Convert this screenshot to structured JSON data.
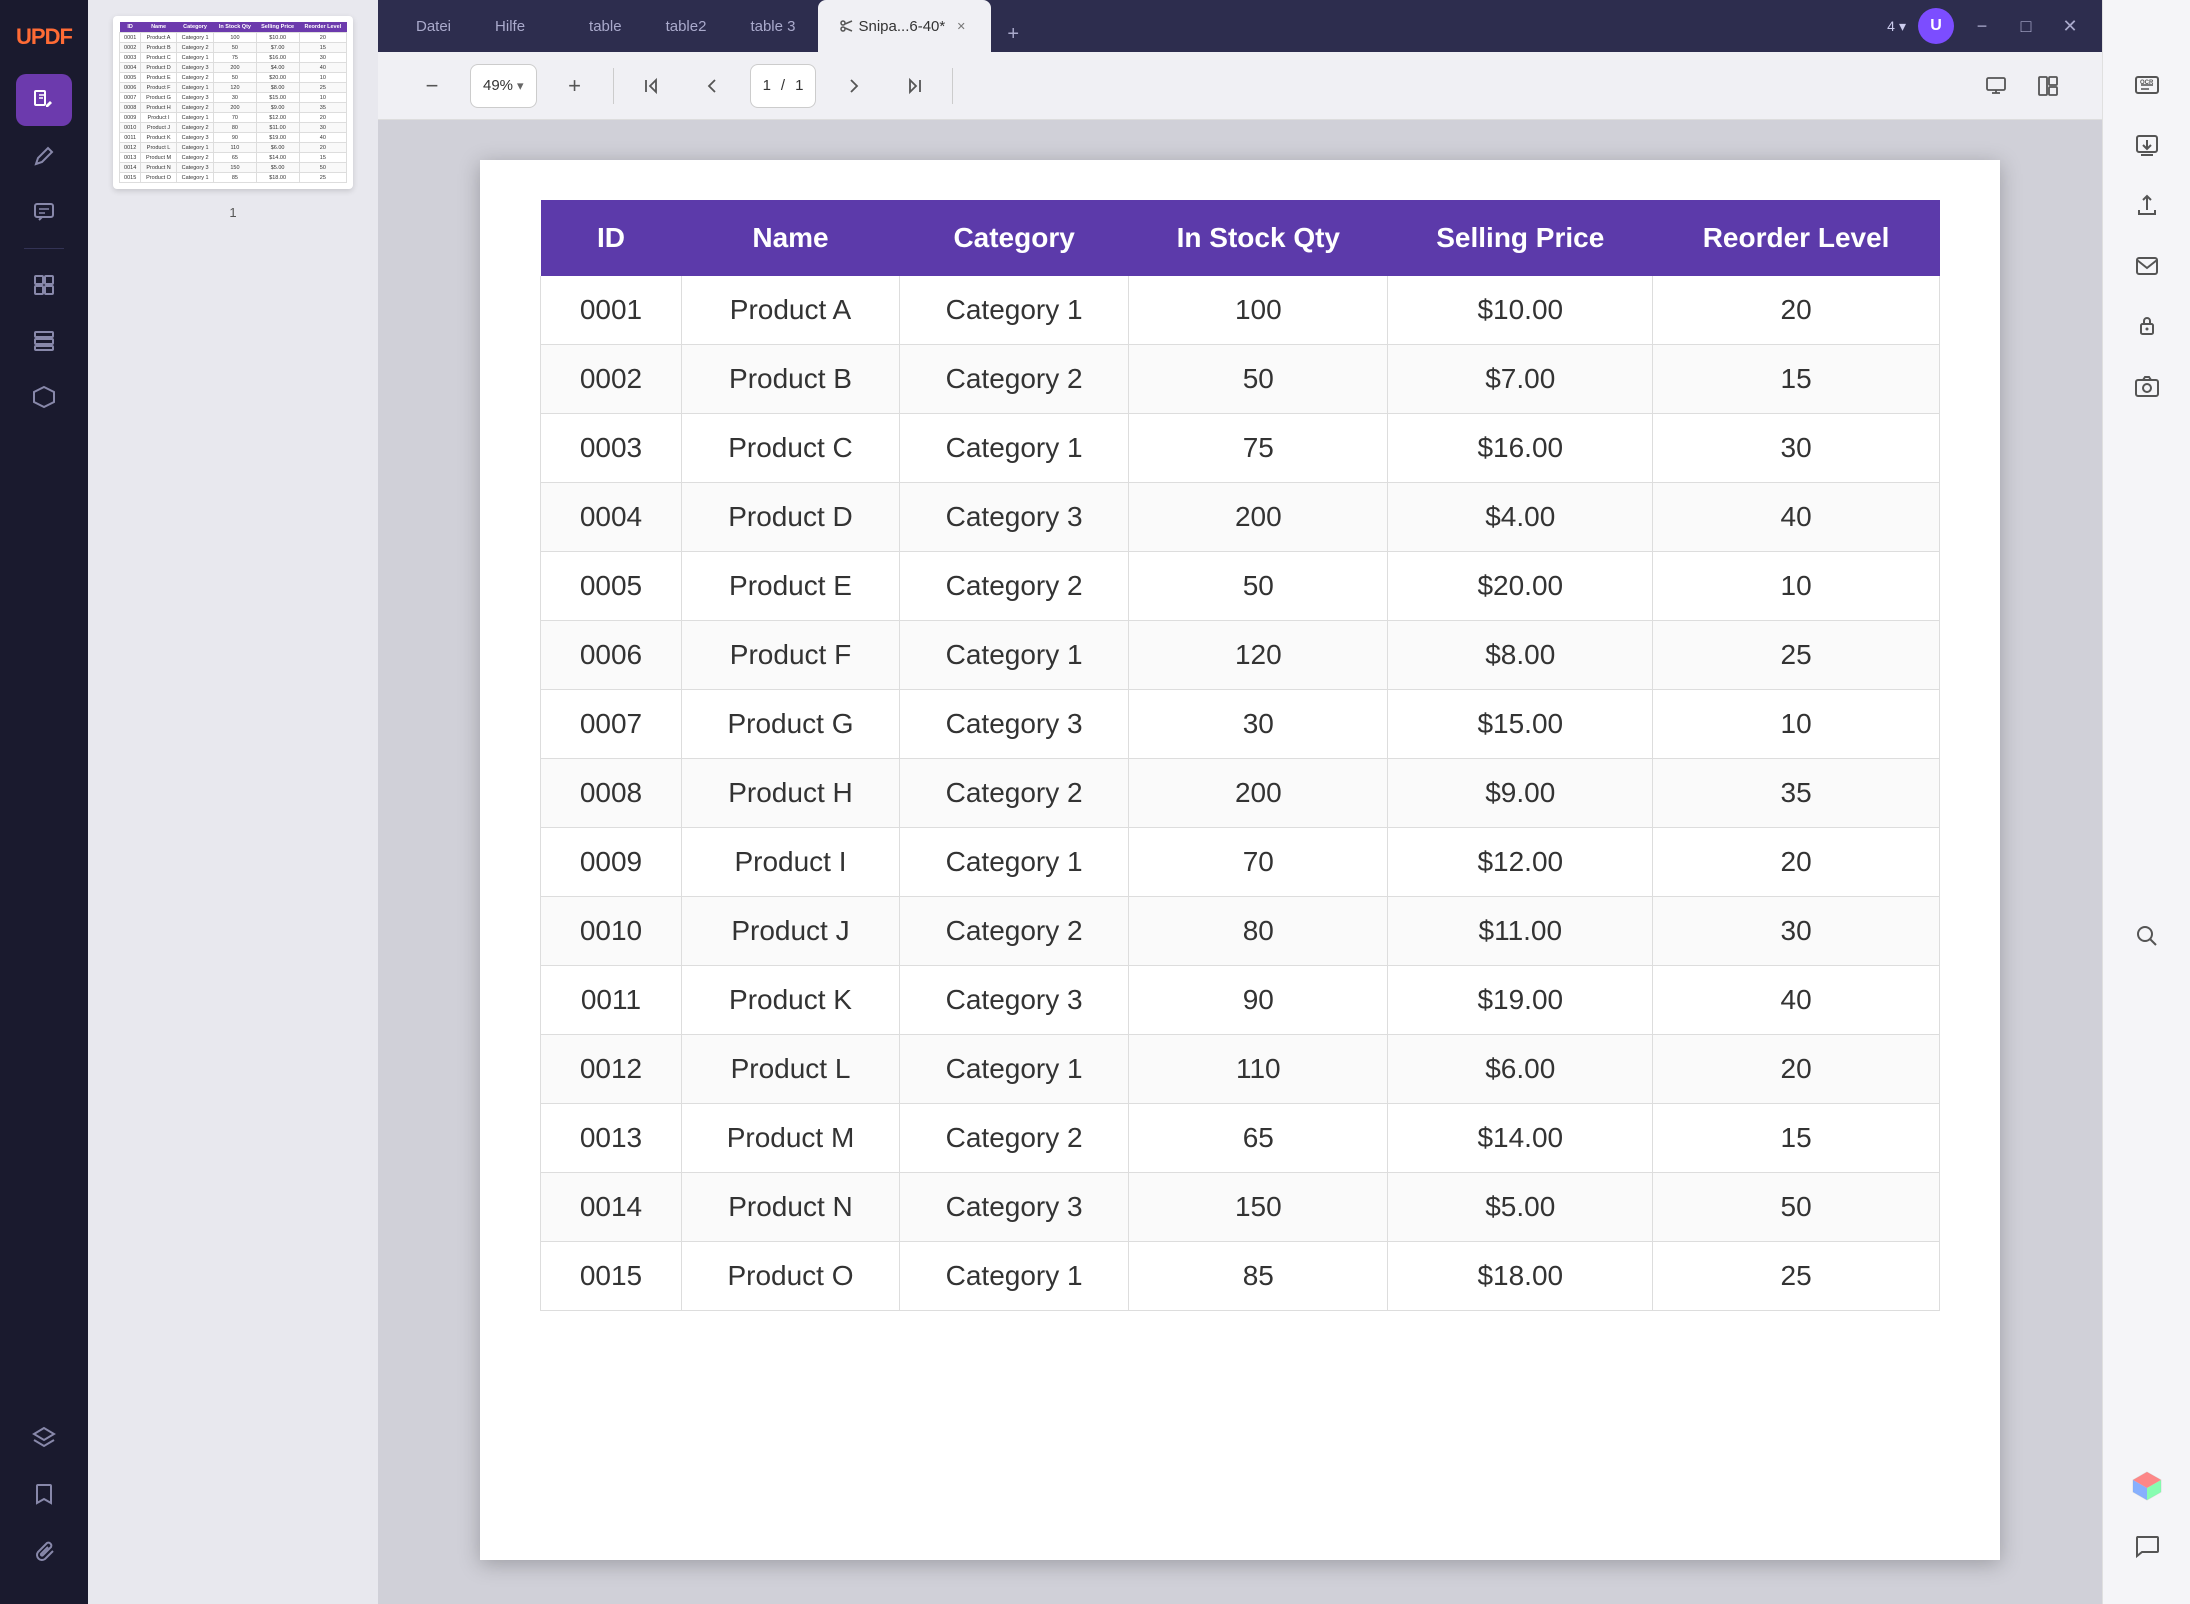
{
  "app": {
    "logo": "UPDF",
    "window_controls": {
      "minimize": "−",
      "maximize": "□",
      "close": "✕"
    }
  },
  "tabs": [
    {
      "label": "Datei",
      "active": false
    },
    {
      "label": "Hilfe",
      "active": false
    },
    {
      "label": "table",
      "active": false
    },
    {
      "label": "table2",
      "active": false
    },
    {
      "label": "table 3",
      "active": false
    },
    {
      "label": "Snipa...6-40*",
      "active": true,
      "closable": true
    }
  ],
  "new_tab_icon": "+",
  "title_bar_right": {
    "page_count": "4",
    "chevron": "▾",
    "avatar": "U"
  },
  "toolbar": {
    "zoom_out": "−",
    "zoom_in": "+",
    "zoom_value": "49%",
    "zoom_chevron": "▾",
    "page_first": "⟨⟨",
    "page_prev": "⟨",
    "page_current": "1",
    "page_separator": "/",
    "page_total": "1",
    "page_next": "⟩",
    "page_last": "⟩⟩"
  },
  "left_sidebar": {
    "icons": [
      {
        "name": "edit-icon",
        "symbol": "✏",
        "active": true
      },
      {
        "name": "annotate-icon",
        "symbol": "✒",
        "active": false
      },
      {
        "name": "comment-icon",
        "symbol": "💬",
        "active": false
      },
      {
        "name": "page-icon",
        "symbol": "⊞",
        "active": false
      },
      {
        "name": "organize-icon",
        "symbol": "⊟",
        "active": false
      },
      {
        "name": "convert-icon",
        "symbol": "⬡",
        "active": false
      }
    ],
    "bottom_icons": [
      {
        "name": "layers-icon",
        "symbol": "⊗"
      },
      {
        "name": "bookmark-icon",
        "symbol": "🔖"
      },
      {
        "name": "attachment-icon",
        "symbol": "📎"
      }
    ]
  },
  "right_sidebar": {
    "icons": [
      {
        "name": "ocr-icon",
        "symbol": "OCR"
      },
      {
        "name": "download-icon",
        "symbol": "↓"
      },
      {
        "name": "upload-icon",
        "symbol": "↑"
      },
      {
        "name": "email-icon",
        "symbol": "✉"
      },
      {
        "name": "password-icon",
        "symbol": "🔒"
      },
      {
        "name": "camera-icon",
        "symbol": "📷"
      },
      {
        "name": "search-icon",
        "symbol": "🔍"
      }
    ],
    "bottom_icons": [
      {
        "name": "chat-icon",
        "symbol": "💬"
      }
    ]
  },
  "thumbnail": {
    "headers": [
      "ID",
      "Name",
      "Category",
      "In Stock Qty",
      "Selling Price",
      "Reorder Level"
    ],
    "rows": [
      [
        "0001",
        "Product A",
        "Category 1",
        "100",
        "$10.00",
        "20"
      ],
      [
        "0002",
        "Product B",
        "Category 2",
        "50",
        "$7.00",
        "15"
      ],
      [
        "0003",
        "Product C",
        "Category 1",
        "75",
        "$16.00",
        "30"
      ],
      [
        "0004",
        "Product D",
        "Category 3",
        "200",
        "$4.00",
        "40"
      ],
      [
        "0005",
        "Product E",
        "Category 2",
        "50",
        "$20.00",
        "10"
      ],
      [
        "0006",
        "Product F",
        "Category 1",
        "120",
        "$8.00",
        "25"
      ],
      [
        "0007",
        "Product G",
        "Category 3",
        "30",
        "$15.00",
        "10"
      ],
      [
        "0008",
        "Product H",
        "Category 2",
        "200",
        "$9.00",
        "35"
      ],
      [
        "0009",
        "Product I",
        "Category 1",
        "70",
        "$12.00",
        "20"
      ],
      [
        "0010",
        "Product J",
        "Category 2",
        "80",
        "$11.00",
        "30"
      ],
      [
        "0011",
        "Product K",
        "Category 3",
        "90",
        "$19.00",
        "40"
      ],
      [
        "0012",
        "Product L",
        "Category 1",
        "110",
        "$6.00",
        "20"
      ],
      [
        "0013",
        "Product M",
        "Category 2",
        "65",
        "$14.00",
        "15"
      ],
      [
        "0014",
        "Product N",
        "Category 3",
        "150",
        "$5.00",
        "50"
      ],
      [
        "0015",
        "Product O",
        "Category 1",
        "85",
        "$18.00",
        "25"
      ]
    ],
    "page_number": "1"
  },
  "table": {
    "headers": [
      "ID",
      "Name",
      "Category",
      "In Stock Qty",
      "Selling Price",
      "Reorder Level"
    ],
    "rows": [
      [
        "0001",
        "Product A",
        "Category 1",
        "100",
        "$10.00",
        "20"
      ],
      [
        "0002",
        "Product B",
        "Category 2",
        "50",
        "$7.00",
        "15"
      ],
      [
        "0003",
        "Product C",
        "Category 1",
        "75",
        "$16.00",
        "30"
      ],
      [
        "0004",
        "Product D",
        "Category 3",
        "200",
        "$4.00",
        "40"
      ],
      [
        "0005",
        "Product E",
        "Category 2",
        "50",
        "$20.00",
        "10"
      ],
      [
        "0006",
        "Product F",
        "Category 1",
        "120",
        "$8.00",
        "25"
      ],
      [
        "0007",
        "Product G",
        "Category 3",
        "30",
        "$15.00",
        "10"
      ],
      [
        "0008",
        "Product H",
        "Category 2",
        "200",
        "$9.00",
        "35"
      ],
      [
        "0009",
        "Product I",
        "Category 1",
        "70",
        "$12.00",
        "20"
      ],
      [
        "0010",
        "Product J",
        "Category 2",
        "80",
        "$11.00",
        "30"
      ],
      [
        "0011",
        "Product K",
        "Category 3",
        "90",
        "$19.00",
        "40"
      ],
      [
        "0012",
        "Product L",
        "Category 1",
        "110",
        "$6.00",
        "20"
      ],
      [
        "0013",
        "Product M",
        "Category 2",
        "65",
        "$14.00",
        "15"
      ],
      [
        "0014",
        "Product N",
        "Category 3",
        "150",
        "$5.00",
        "50"
      ],
      [
        "0015",
        "Product O",
        "Category 1",
        "85",
        "$18.00",
        "25"
      ]
    ]
  },
  "colors": {
    "table_header_bg": "#5c3aaa",
    "sidebar_bg": "#1a1a2e",
    "active_icon_bg": "#6c3aad",
    "logo_color": "#ff6b35"
  }
}
